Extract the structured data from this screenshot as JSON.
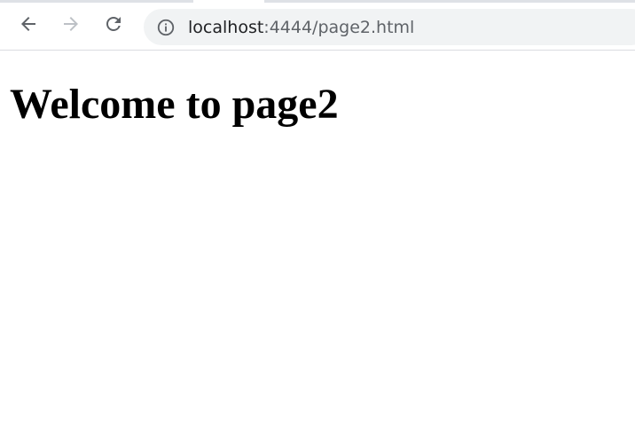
{
  "browser": {
    "toolbar": {
      "back_icon": "arrow-left-icon",
      "forward_icon": "arrow-right-icon",
      "reload_icon": "reload-icon",
      "forward_disabled": true
    },
    "omnibox": {
      "site_info_icon": "info-icon",
      "url_host": "localhost",
      "url_rest": ":4444/page2.html"
    },
    "colors": {
      "omnibox_bg": "#f1f3f4",
      "icon_active": "#5f6368",
      "icon_disabled": "#bdc1c6"
    }
  },
  "page": {
    "heading": "Welcome to page2"
  }
}
